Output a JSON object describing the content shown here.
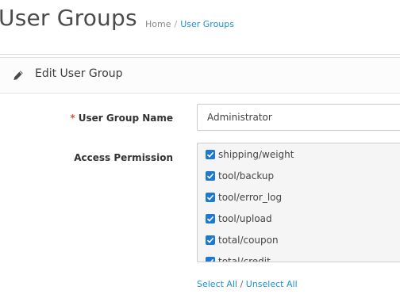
{
  "header": {
    "title": "User Groups",
    "breadcrumb": [
      {
        "label": "Home"
      },
      {
        "label": "User Groups"
      }
    ],
    "breadcrumb_separator": "/"
  },
  "panel": {
    "icon": "pencil-icon",
    "title": "Edit User Group"
  },
  "form": {
    "group_name": {
      "required_mark": "*",
      "label": "User Group Name",
      "value": "Administrator"
    },
    "access_permission": {
      "label": "Access Permission",
      "items": [
        {
          "label": "shipping/weight",
          "checked": true
        },
        {
          "label": "tool/backup",
          "checked": true
        },
        {
          "label": "tool/error_log",
          "checked": true
        },
        {
          "label": "tool/upload",
          "checked": true
        },
        {
          "label": "total/coupon",
          "checked": true
        },
        {
          "label": "total/credit",
          "checked": true
        }
      ],
      "select_all": "Select All",
      "link_separator": " / ",
      "unselect_all": "Unselect All"
    }
  },
  "colors": {
    "accent": "#1e91cf",
    "checkbox": "#1e7ad0",
    "required": "#e3503e"
  }
}
